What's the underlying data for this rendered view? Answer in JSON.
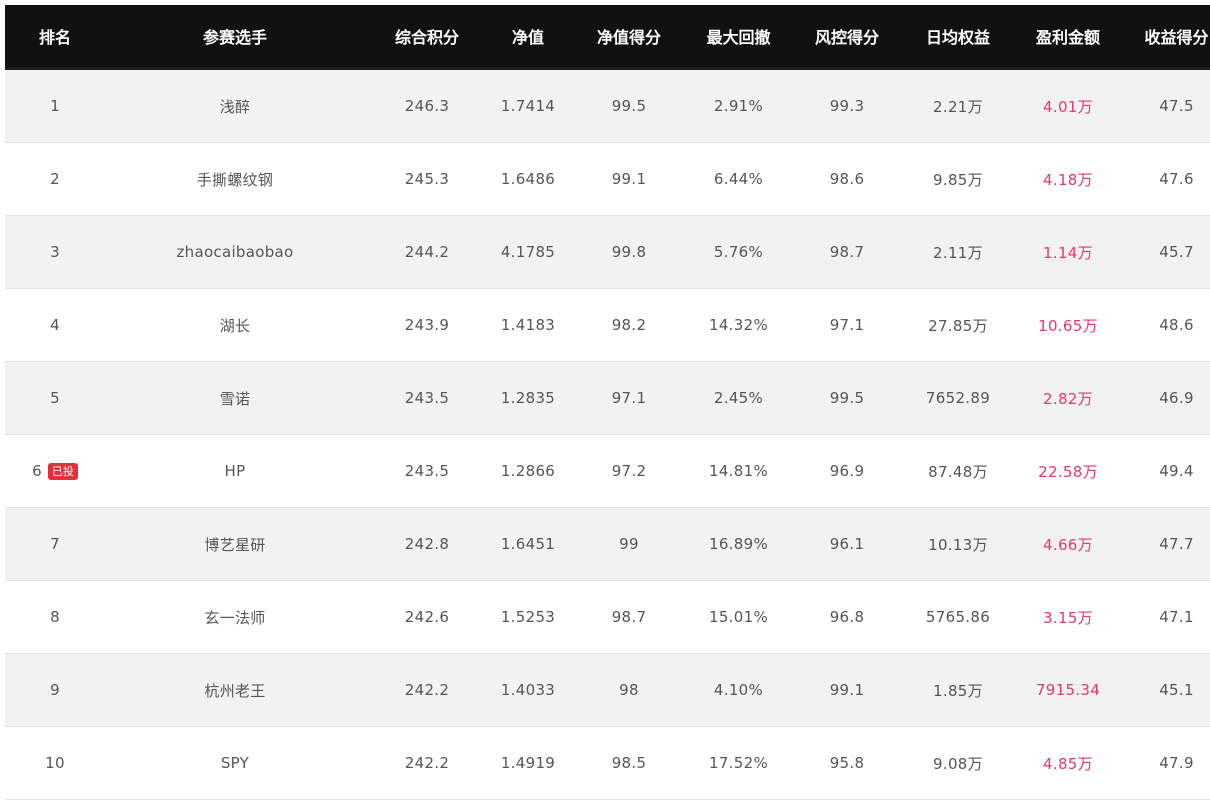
{
  "headers": [
    "排名",
    "参赛选手",
    "综合积分",
    "净值",
    "净值得分",
    "最大回撤",
    "风控得分",
    "日均权益",
    "盈利金额",
    "收益得分"
  ],
  "colors": {
    "header_bg": "#111111",
    "profit": "#e8366e",
    "badge_bg": "#e0313b"
  },
  "rows": [
    {
      "rank": "1",
      "badge": "",
      "player": "浅醉",
      "score": "246.3",
      "nav": "1.7414",
      "nav_score": "99.5",
      "max_drawdown": "2.91%",
      "risk_score": "99.3",
      "avg_equity": "2.21万",
      "profit": "4.01万",
      "return_score": "47.5"
    },
    {
      "rank": "2",
      "badge": "",
      "player": "手撕螺纹钢",
      "score": "245.3",
      "nav": "1.6486",
      "nav_score": "99.1",
      "max_drawdown": "6.44%",
      "risk_score": "98.6",
      "avg_equity": "9.85万",
      "profit": "4.18万",
      "return_score": "47.6"
    },
    {
      "rank": "3",
      "badge": "",
      "player": "zhaocaibaobao",
      "score": "244.2",
      "nav": "4.1785",
      "nav_score": "99.8",
      "max_drawdown": "5.76%",
      "risk_score": "98.7",
      "avg_equity": "2.11万",
      "profit": "1.14万",
      "return_score": "45.7"
    },
    {
      "rank": "4",
      "badge": "",
      "player": "湖长",
      "score": "243.9",
      "nav": "1.4183",
      "nav_score": "98.2",
      "max_drawdown": "14.32%",
      "risk_score": "97.1",
      "avg_equity": "27.85万",
      "profit": "10.65万",
      "return_score": "48.6"
    },
    {
      "rank": "5",
      "badge": "",
      "player": "雪诺",
      "score": "243.5",
      "nav": "1.2835",
      "nav_score": "97.1",
      "max_drawdown": "2.45%",
      "risk_score": "99.5",
      "avg_equity": "7652.89",
      "profit": "2.82万",
      "return_score": "46.9"
    },
    {
      "rank": "6",
      "badge": "已投",
      "player": "HP",
      "score": "243.5",
      "nav": "1.2866",
      "nav_score": "97.2",
      "max_drawdown": "14.81%",
      "risk_score": "96.9",
      "avg_equity": "87.48万",
      "profit": "22.58万",
      "return_score": "49.4"
    },
    {
      "rank": "7",
      "badge": "",
      "player": "博艺星研",
      "score": "242.8",
      "nav": "1.6451",
      "nav_score": "99",
      "max_drawdown": "16.89%",
      "risk_score": "96.1",
      "avg_equity": "10.13万",
      "profit": "4.66万",
      "return_score": "47.7"
    },
    {
      "rank": "8",
      "badge": "",
      "player": "玄一法师",
      "score": "242.6",
      "nav": "1.5253",
      "nav_score": "98.7",
      "max_drawdown": "15.01%",
      "risk_score": "96.8",
      "avg_equity": "5765.86",
      "profit": "3.15万",
      "return_score": "47.1"
    },
    {
      "rank": "9",
      "badge": "",
      "player": "杭州老王",
      "score": "242.2",
      "nav": "1.4033",
      "nav_score": "98",
      "max_drawdown": "4.10%",
      "risk_score": "99.1",
      "avg_equity": "1.85万",
      "profit": "7915.34",
      "return_score": "45.1"
    },
    {
      "rank": "10",
      "badge": "",
      "player": "SPY",
      "score": "242.2",
      "nav": "1.4919",
      "nav_score": "98.5",
      "max_drawdown": "17.52%",
      "risk_score": "95.8",
      "avg_equity": "9.08万",
      "profit": "4.85万",
      "return_score": "47.9"
    }
  ]
}
